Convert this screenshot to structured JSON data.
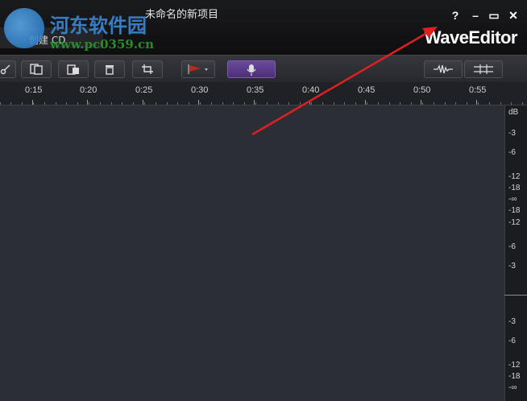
{
  "window": {
    "title": "未命名的新项目",
    "help": "?",
    "minimize": "–",
    "maximize": "▭",
    "close": "✕",
    "brand": "WaveEditor"
  },
  "tab": {
    "label": "创建 CD"
  },
  "watermark": {
    "title": "河东软件园",
    "url": "www.pc0359.cn"
  },
  "toolbar": {
    "buttons": [
      "cut-icon",
      "copy-icon",
      "paste-icon",
      "delete-icon",
      "crop-icon",
      "marker-icon",
      "record-icon",
      "waveform-icon",
      "spectral-icon"
    ]
  },
  "timeline": {
    "ticks": [
      "0:15",
      "0:20",
      "0:25",
      "0:30",
      "0:35",
      "0:40",
      "0:45",
      "0:50",
      "0:55"
    ]
  },
  "meter": {
    "unit": "dB",
    "upper": [
      "-3",
      "-6",
      "-12",
      "-18",
      "-∞",
      "-18",
      "-12",
      "-6",
      "-3"
    ],
    "lower": [
      "-3",
      "-6",
      "-12",
      "-18",
      "-∞"
    ]
  },
  "colors": {
    "accent": "#e02020",
    "record_button": "#5a3a8a",
    "background": "#2b2e35"
  }
}
